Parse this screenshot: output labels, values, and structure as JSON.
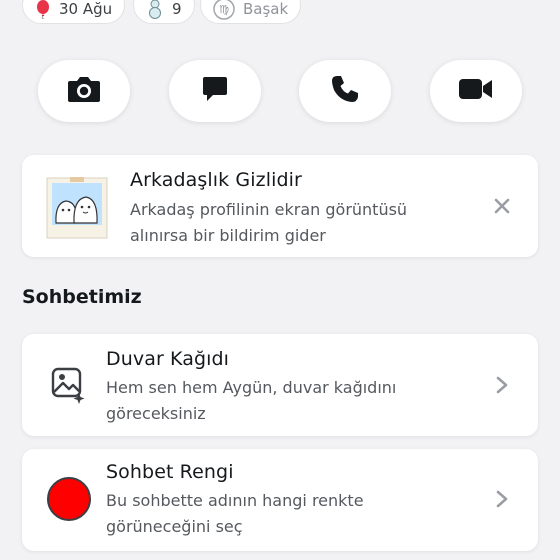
{
  "chips": [
    {
      "icon": "balloon-icon",
      "label": "30 Ağu"
    },
    {
      "icon": "snowman-icon",
      "label": "9"
    },
    {
      "icon": "virgo-icon",
      "label": "Başak"
    }
  ],
  "actions": [
    {
      "icon": "camera-icon"
    },
    {
      "icon": "chat-icon"
    },
    {
      "icon": "phone-icon"
    },
    {
      "icon": "video-icon"
    }
  ],
  "privacy_card": {
    "title": "Arkadaşlık Gizlidir",
    "desc_line1": "Arkadaş profilinin ekran görüntüsü",
    "desc_line2": "alınırsa bir bildirim gider",
    "dismiss_icon": "close-icon"
  },
  "section": {
    "title": "Sohbetimiz"
  },
  "wallpaper": {
    "title": "Duvar Kağıdı",
    "desc_line1": "Hem sen hem Aygün, duvar kağıdını",
    "desc_line2": "göreceksiniz",
    "icon": "wallpaper-icon"
  },
  "chat_color": {
    "title": "Sohbet Rengi",
    "desc_line1": "Bu sohbette adının hangi renkte",
    "desc_line2": "görüneceğini seç",
    "color": "#ff0000"
  }
}
